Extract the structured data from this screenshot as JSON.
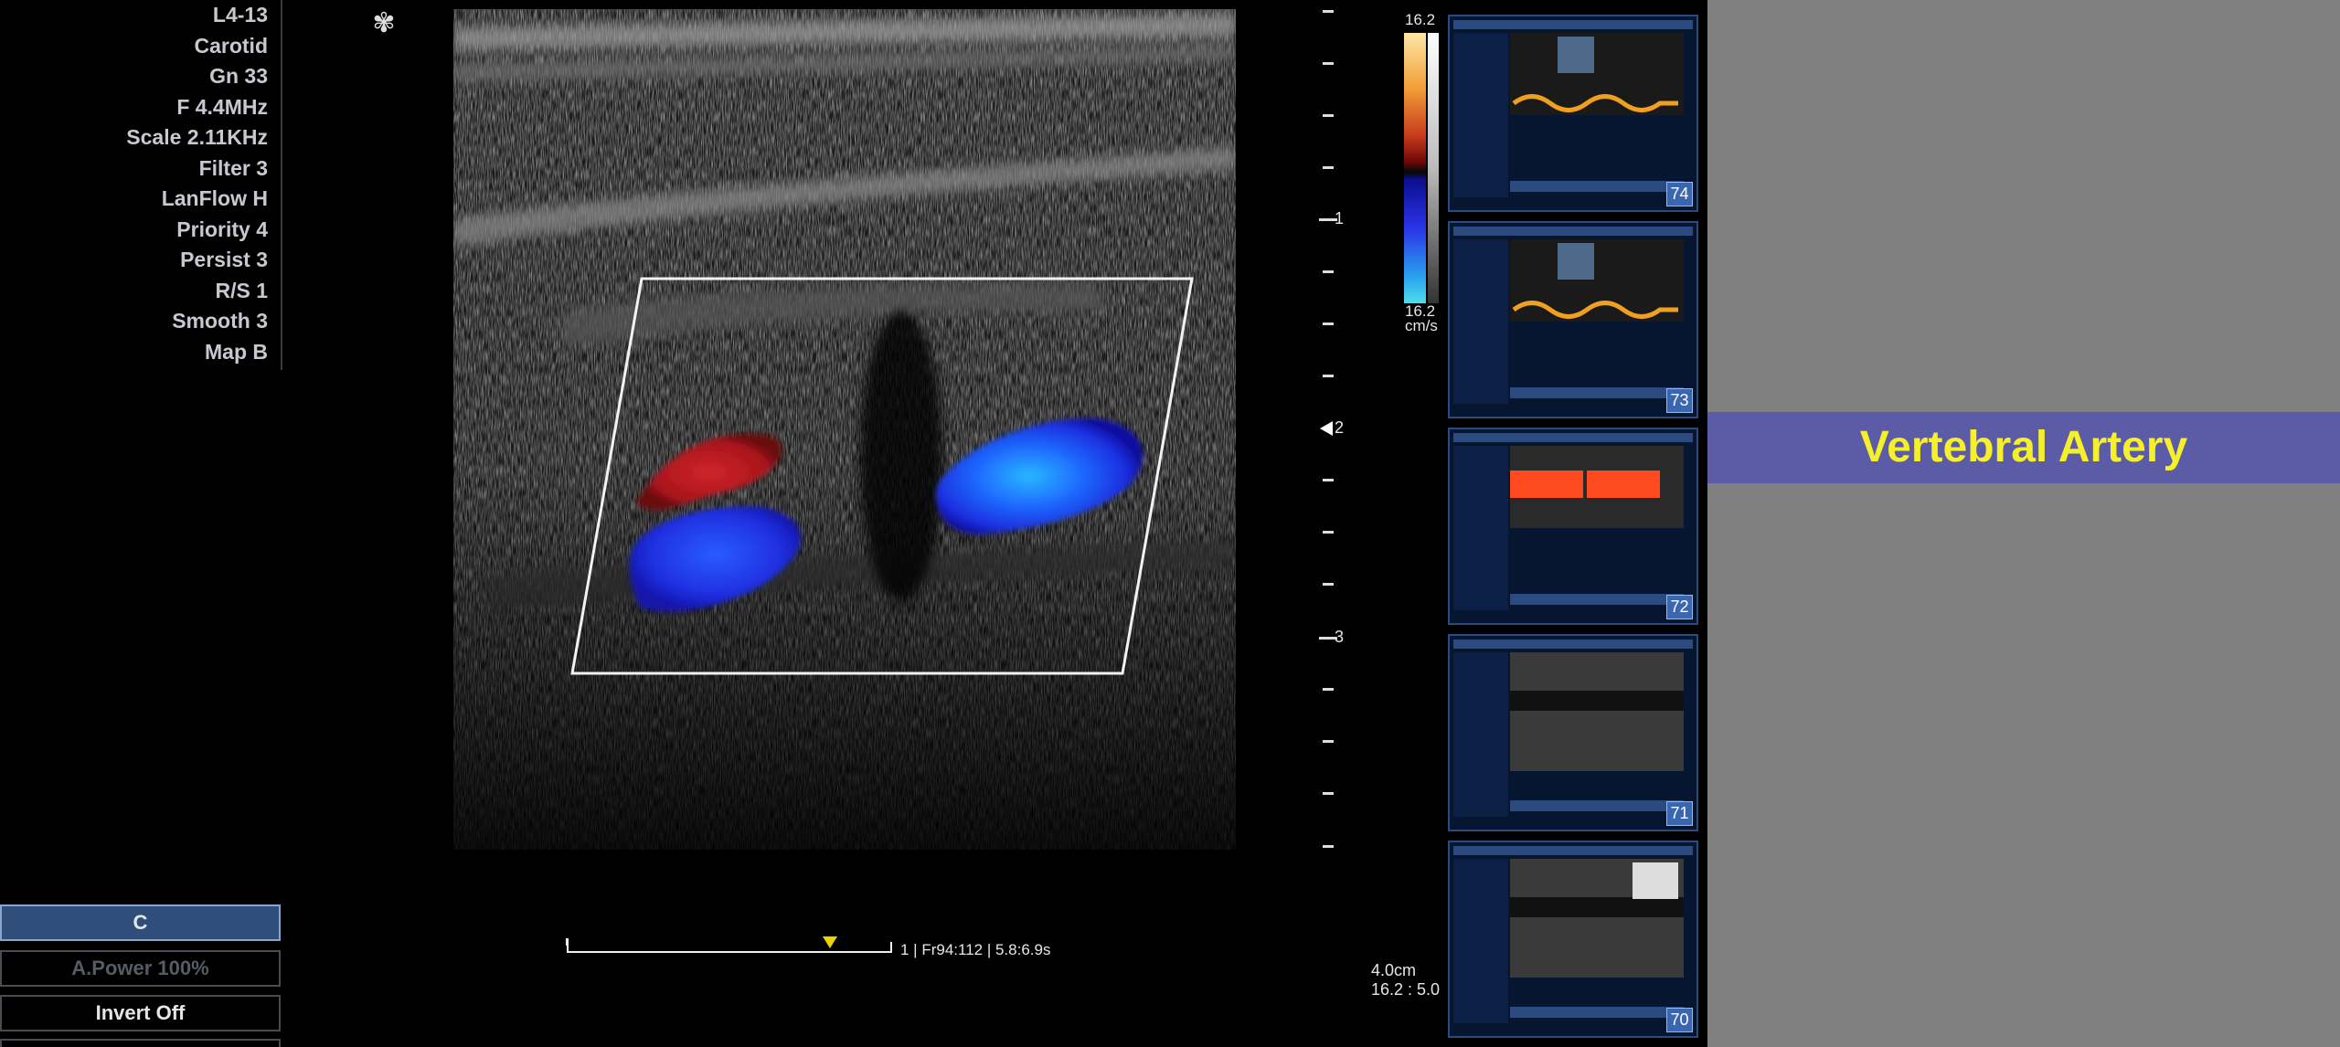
{
  "parameters": [
    "L4-13",
    "Carotid",
    "Gn 33",
    "F 4.4MHz",
    "Scale 2.11KHz",
    "Filter 3",
    "LanFlow H",
    "Priority 4",
    "Persist 3",
    "R/S 1",
    "Smooth 3",
    "Map B"
  ],
  "menu": {
    "c_label": "C",
    "apower_label": "A.Power 100%",
    "invert_label": "Invert  Off"
  },
  "depth_labels": [
    "1",
    "2",
    "3"
  ],
  "color_bar": {
    "top": "16.2",
    "bottom": "16.2",
    "unit": "cm/s"
  },
  "cine_info": "1 | Fr94:112 | 5.8:6.9s",
  "bottom_info": {
    "depth": "4.0cm",
    "ratio": "16.2 : 5.0"
  },
  "thumbnails": [
    "74",
    "73",
    "72",
    "71",
    "70"
  ],
  "title": "Vertebral Artery",
  "icons": {
    "focus": "flower-icon",
    "cine_marker": "yellow-triangle-marker"
  },
  "colors": {
    "banner": "#5b5ba8",
    "title": "#f5f02a",
    "side_panel": "#808080"
  }
}
